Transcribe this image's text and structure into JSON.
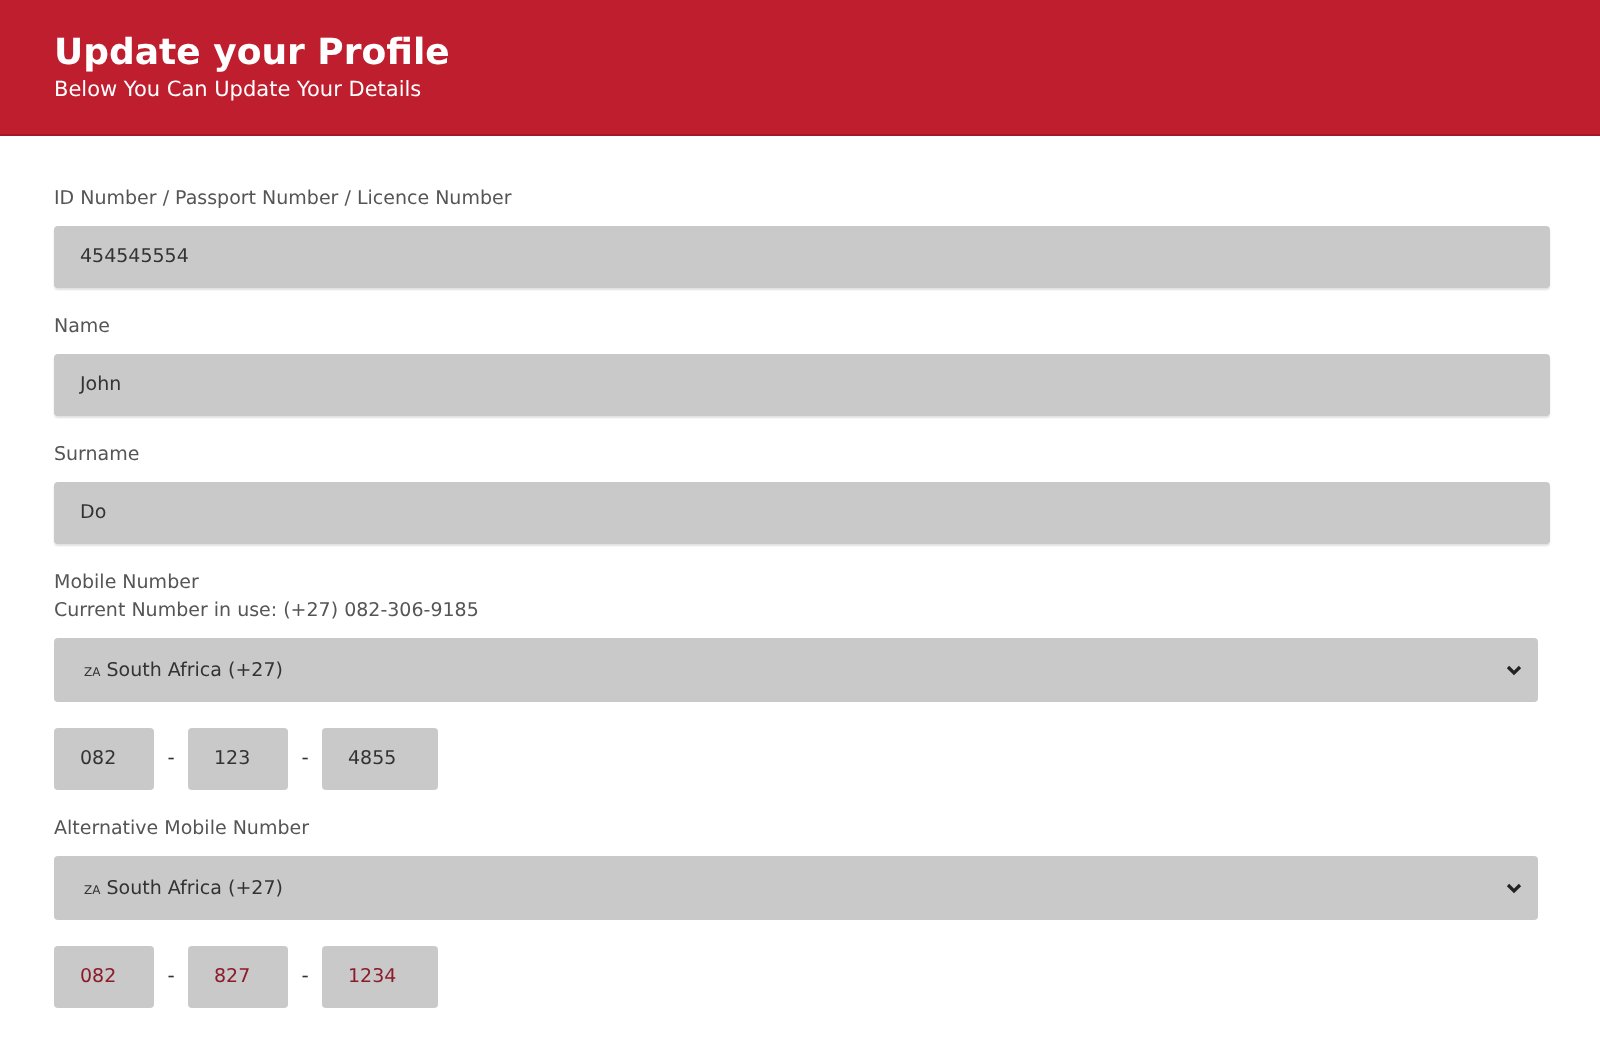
{
  "header": {
    "title": "Update your Profile",
    "subtitle": "Below You Can Update Your Details"
  },
  "fields": [
    {
      "kind": "text",
      "label": "ID Number / Passport Number / Licence Number",
      "value": "454545554"
    },
    {
      "kind": "text",
      "label": "Name",
      "value": "John"
    },
    {
      "kind": "text",
      "label": "Surname",
      "value": "Do"
    },
    {
      "kind": "phone",
      "label": "Mobile Number",
      "note": "Current Number in use: (+27) 082-306-9185",
      "country_code": "ZA",
      "country": "South Africa (+27)",
      "color": "#333333",
      "parts": [
        "082",
        "123",
        "4855"
      ],
      "separator": "-"
    },
    {
      "kind": "phone",
      "label": "Alternative Mobile Number",
      "country_code": "ZA",
      "country": "South Africa (+27)",
      "color": "#8b1a2b",
      "parts": [
        "082",
        "827",
        "1234"
      ],
      "separator": "-"
    }
  ]
}
